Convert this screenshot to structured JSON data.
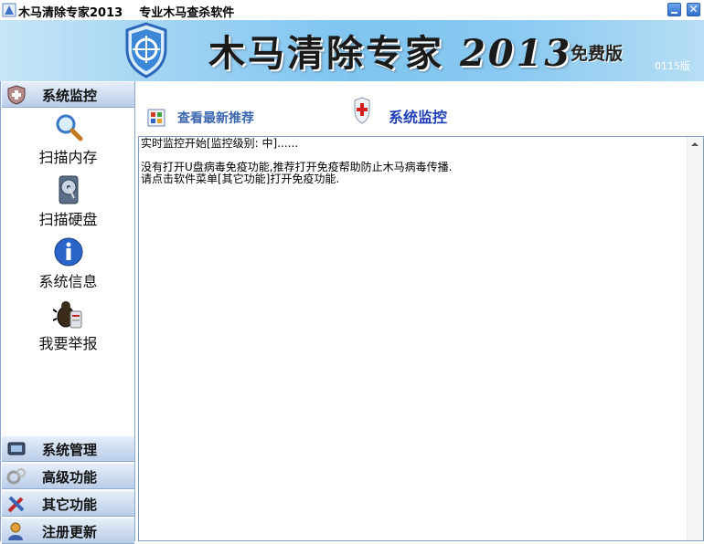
{
  "window": {
    "title": "木马清除专家2013    专业木马查杀软件",
    "close_glyph": "✕"
  },
  "banner": {
    "title": "木马清除专家",
    "year": "2013",
    "edition": "免费版",
    "version": "0115版"
  },
  "sidebar": {
    "top_category": "系统监控",
    "items": [
      {
        "label": "扫描内存",
        "icon": "magnifier-icon"
      },
      {
        "label": "扫描硬盘",
        "icon": "hard-disk-icon"
      },
      {
        "label": "系统信息",
        "icon": "info-icon"
      },
      {
        "label": "我要举报",
        "icon": "bug-report-icon"
      }
    ],
    "bottom_categories": [
      {
        "label": "系统管理",
        "icon": "system-manage-icon"
      },
      {
        "label": "高级功能",
        "icon": "advanced-gears-icon"
      },
      {
        "label": "其它功能",
        "icon": "tools-icon"
      },
      {
        "label": "注册更新",
        "icon": "register-user-icon"
      }
    ]
  },
  "main": {
    "recommend_link": "查看最新推荐",
    "section_title": "系统监控",
    "log_lines": [
      "实时监控开始[监控级别: 中]......",
      "",
      "没有打开U盘病毒免疫功能,推荐打开免疫帮助防止木马病毒传播.",
      "请点击软件菜单[其它功能]打开免疫功能."
    ]
  },
  "colors": {
    "banner_accent": "#7ec5f0",
    "category_bg": "#b9cde9",
    "link_blue": "#3b67b0",
    "title_blue": "#1f3fb8"
  }
}
